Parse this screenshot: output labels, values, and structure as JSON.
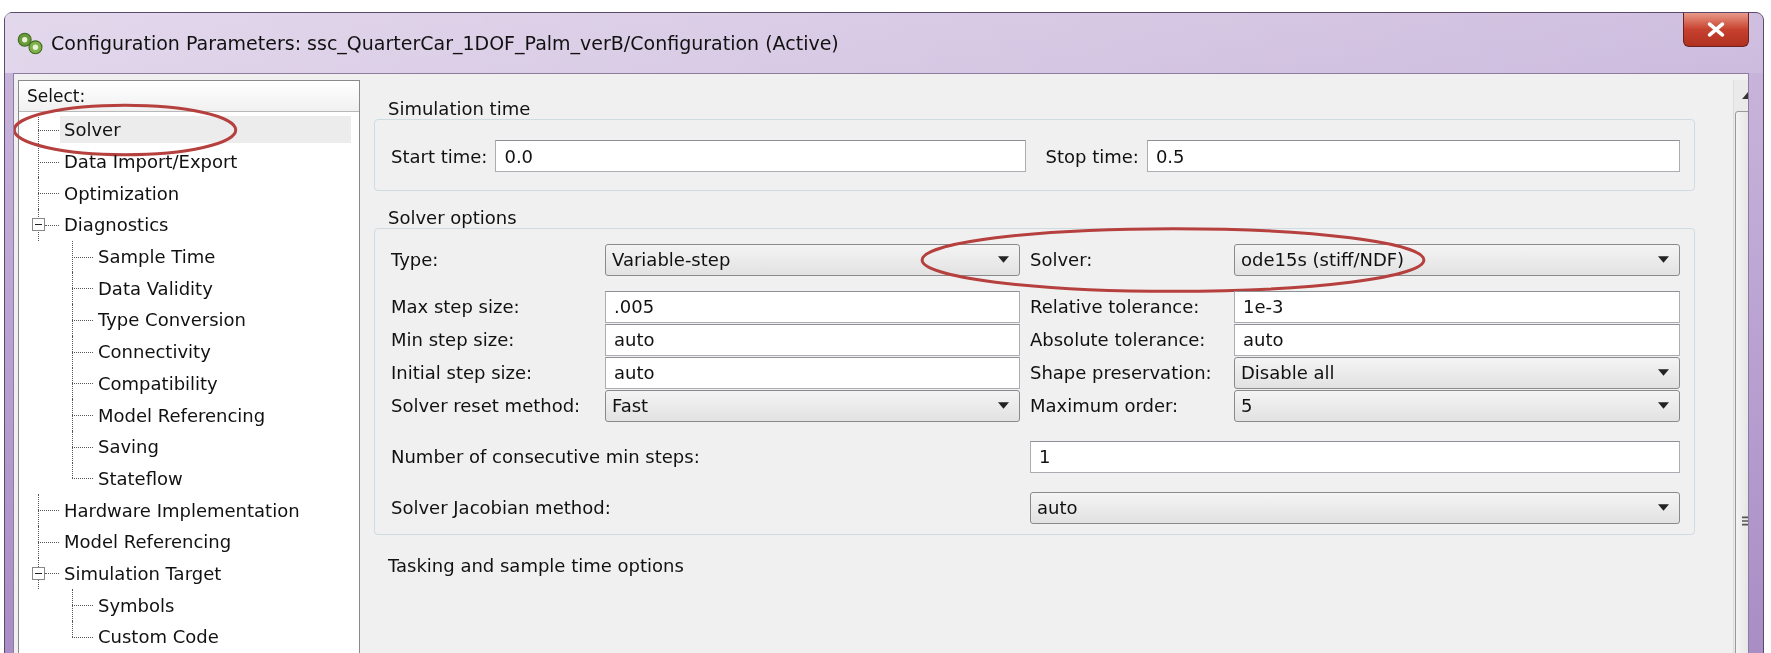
{
  "window": {
    "title": "Configuration Parameters: ssc_QuarterCar_1DOF_Palm_verB/Configuration (Active)"
  },
  "tree": {
    "header": "Select:",
    "items": [
      {
        "label": "Solver",
        "selected": true,
        "circled": true
      },
      {
        "label": "Data Import/Export",
        "selected": false
      },
      {
        "label": "Optimization",
        "selected": false
      },
      {
        "label": "Diagnostics",
        "selected": false,
        "expanded": true,
        "children": [
          {
            "label": "Sample Time",
            "selected": false
          },
          {
            "label": "Data Validity",
            "selected": false
          },
          {
            "label": "Type Conversion",
            "selected": false
          },
          {
            "label": "Connectivity",
            "selected": false
          },
          {
            "label": "Compatibility",
            "selected": false
          },
          {
            "label": "Model Referencing",
            "selected": false
          },
          {
            "label": "Saving",
            "selected": false
          },
          {
            "label": "Stateflow",
            "selected": false
          }
        ]
      },
      {
        "label": "Hardware Implementation",
        "selected": false
      },
      {
        "label": "Model Referencing",
        "selected": false
      },
      {
        "label": "Simulation Target",
        "selected": false,
        "expanded": true,
        "children": [
          {
            "label": "Symbols",
            "selected": false
          },
          {
            "label": "Custom Code",
            "selected": false
          }
        ]
      }
    ]
  },
  "sections": [
    {
      "title": "Simulation time",
      "rows": [
        [
          {
            "label": "Start time:",
            "kind": "text",
            "value": "0.0"
          },
          {
            "label": "Stop time:",
            "kind": "text",
            "value": "0.5"
          }
        ]
      ]
    },
    {
      "title": "Solver options",
      "rows": [
        [
          {
            "label": "Type:",
            "kind": "dropdown",
            "value": "Variable-step"
          },
          {
            "label": "Solver:",
            "kind": "dropdown",
            "value": "ode15s (stiff/NDF)",
            "circled": true
          }
        ],
        [
          {
            "label": "Max step size:",
            "kind": "text",
            "value": ".005"
          },
          {
            "label": "Relative tolerance:",
            "kind": "text",
            "value": "1e-3"
          }
        ],
        [
          {
            "label": "Min step size:",
            "kind": "text",
            "value": "auto"
          },
          {
            "label": "Absolute tolerance:",
            "kind": "text",
            "value": "auto"
          }
        ],
        [
          {
            "label": "Initial step size:",
            "kind": "text",
            "value": "auto"
          },
          {
            "label": "Shape preservation:",
            "kind": "dropdown",
            "value": "Disable all"
          }
        ],
        [
          {
            "label": "Solver reset method:",
            "kind": "dropdown",
            "value": "Fast"
          },
          {
            "label": "Maximum order:",
            "kind": "dropdown",
            "value": "5"
          }
        ],
        [
          {
            "label": "Number of consecutive min steps:",
            "kind": "text",
            "value": "1"
          }
        ],
        [
          {
            "label": "Solver Jacobian method:",
            "kind": "dropdown",
            "value": "auto"
          }
        ]
      ]
    },
    {
      "title": "Tasking and sample time options"
    }
  ]
}
